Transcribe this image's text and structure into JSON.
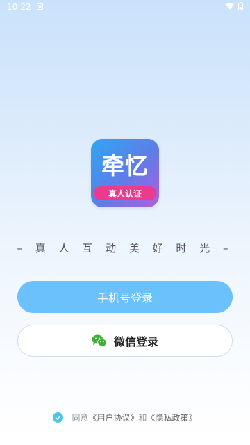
{
  "status_bar": {
    "time": "10:22",
    "icons": [
      "notification-icon",
      "wifi-icon",
      "battery-icon"
    ]
  },
  "logo": {
    "title": "牵忆",
    "badge": "真人认证"
  },
  "slogan": "– 真 人 互 动 美 好 时 光 –",
  "buttons": {
    "phone_login": "手机号登录",
    "wechat_login": "微信登录"
  },
  "agreement": {
    "prefix": "同意",
    "user_agreement": "《用户协议》",
    "and": "和",
    "privacy_policy": "《隐私政策》"
  },
  "colors": {
    "primary_button": "#6bc1fb",
    "wechat_green": "#3cb034",
    "checkbox": "#4bc6e6",
    "badge_pink": "#ec3a8f"
  }
}
